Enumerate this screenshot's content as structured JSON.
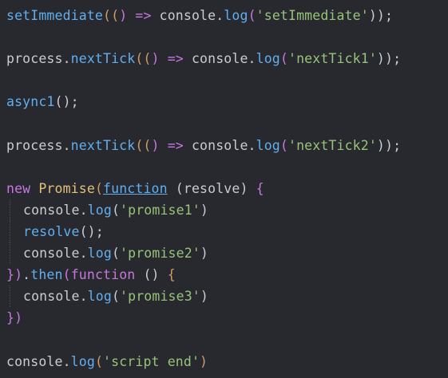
{
  "editor": {
    "lines": [
      {
        "indent": 0,
        "tokens": [
          {
            "t": "setImmediate",
            "c": "fn"
          },
          {
            "t": "((",
            "c": "paren"
          },
          {
            "t": ") ",
            "c": "paren2"
          },
          {
            "t": "=>",
            "c": "arrow"
          },
          {
            "t": " console.",
            "c": "default"
          },
          {
            "t": "log",
            "c": "fn"
          },
          {
            "t": "(",
            "c": "paren2"
          },
          {
            "t": "'setImmediate'",
            "c": "str"
          },
          {
            "t": "));",
            "c": "default"
          }
        ]
      },
      {
        "indent": 0,
        "tokens": []
      },
      {
        "indent": 0,
        "tokens": [
          {
            "t": "process.",
            "c": "default"
          },
          {
            "t": "nextTick",
            "c": "fn"
          },
          {
            "t": "((",
            "c": "paren"
          },
          {
            "t": ") ",
            "c": "paren2"
          },
          {
            "t": "=>",
            "c": "arrow"
          },
          {
            "t": " console.",
            "c": "default"
          },
          {
            "t": "log",
            "c": "fn"
          },
          {
            "t": "(",
            "c": "paren2"
          },
          {
            "t": "'nextTick1'",
            "c": "str"
          },
          {
            "t": "));",
            "c": "default"
          }
        ]
      },
      {
        "indent": 0,
        "tokens": []
      },
      {
        "indent": 0,
        "tokens": [
          {
            "t": "async1",
            "c": "fn"
          },
          {
            "t": "();",
            "c": "default"
          }
        ]
      },
      {
        "indent": 0,
        "tokens": []
      },
      {
        "indent": 0,
        "tokens": [
          {
            "t": "process.",
            "c": "default"
          },
          {
            "t": "nextTick",
            "c": "fn"
          },
          {
            "t": "((",
            "c": "paren"
          },
          {
            "t": ") ",
            "c": "paren2"
          },
          {
            "t": "=>",
            "c": "arrow"
          },
          {
            "t": " console.",
            "c": "default"
          },
          {
            "t": "log",
            "c": "fn"
          },
          {
            "t": "(",
            "c": "paren2"
          },
          {
            "t": "'nextTick2'",
            "c": "str"
          },
          {
            "t": "));",
            "c": "default"
          }
        ]
      },
      {
        "indent": 0,
        "tokens": []
      },
      {
        "indent": 0,
        "tokens": [
          {
            "t": "new ",
            "c": "kw"
          },
          {
            "t": "Promise",
            "c": "class"
          },
          {
            "t": "(",
            "c": "paren"
          },
          {
            "t": "function",
            "c": "kw-ul"
          },
          {
            "t": " (resolve) ",
            "c": "default"
          },
          {
            "t": "{",
            "c": "paren2"
          }
        ]
      },
      {
        "indent": 1,
        "tokens": [
          {
            "t": "console.",
            "c": "default"
          },
          {
            "t": "log",
            "c": "fn"
          },
          {
            "t": "(",
            "c": "default"
          },
          {
            "t": "'promise1'",
            "c": "str"
          },
          {
            "t": ")",
            "c": "default"
          }
        ]
      },
      {
        "indent": 1,
        "tokens": [
          {
            "t": "resolve",
            "c": "fn"
          },
          {
            "t": "();",
            "c": "default"
          }
        ]
      },
      {
        "indent": 1,
        "tokens": [
          {
            "t": "console.",
            "c": "default"
          },
          {
            "t": "log",
            "c": "fn"
          },
          {
            "t": "(",
            "c": "default"
          },
          {
            "t": "'promise2'",
            "c": "str"
          },
          {
            "t": ")",
            "c": "default"
          }
        ]
      },
      {
        "indent": 0,
        "tokens": [
          {
            "t": "})",
            "c": "paren2"
          },
          {
            "t": ".",
            "c": "default"
          },
          {
            "t": "then",
            "c": "fn"
          },
          {
            "t": "(",
            "c": "paren2"
          },
          {
            "t": "function",
            "c": "kw"
          },
          {
            "t": " () ",
            "c": "default"
          },
          {
            "t": "{",
            "c": "paren"
          }
        ]
      },
      {
        "indent": 1,
        "tokens": [
          {
            "t": "console.",
            "c": "default"
          },
          {
            "t": "log",
            "c": "fn"
          },
          {
            "t": "(",
            "c": "default"
          },
          {
            "t": "'promise3'",
            "c": "str"
          },
          {
            "t": ")",
            "c": "default"
          }
        ]
      },
      {
        "indent": 0,
        "tokens": [
          {
            "t": "})",
            "c": "paren2"
          }
        ]
      },
      {
        "indent": 0,
        "tokens": []
      },
      {
        "indent": 0,
        "tokens": [
          {
            "t": "console.",
            "c": "default"
          },
          {
            "t": "log",
            "c": "fn"
          },
          {
            "t": "(",
            "c": "paren"
          },
          {
            "t": "'script end'",
            "c": "str"
          },
          {
            "t": ")",
            "c": "paren"
          }
        ]
      }
    ]
  }
}
